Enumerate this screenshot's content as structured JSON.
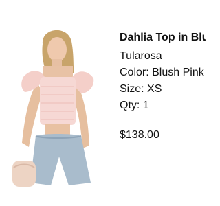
{
  "product": {
    "title": "Dahlia Top in Blush Pink",
    "brand": "Tularosa",
    "color_line": "Color: Blush Pink",
    "size_line": "Size: XS",
    "qty_line": "Qty: 1",
    "price": "$138.00",
    "image_alt": "model wearing blush pink ruffle crop top and denim shorts"
  },
  "colors": {
    "blush": "#f6d8d4",
    "denim": "#a9bccc",
    "skin": "#e9c6aa",
    "hair": "#c8a46a"
  }
}
